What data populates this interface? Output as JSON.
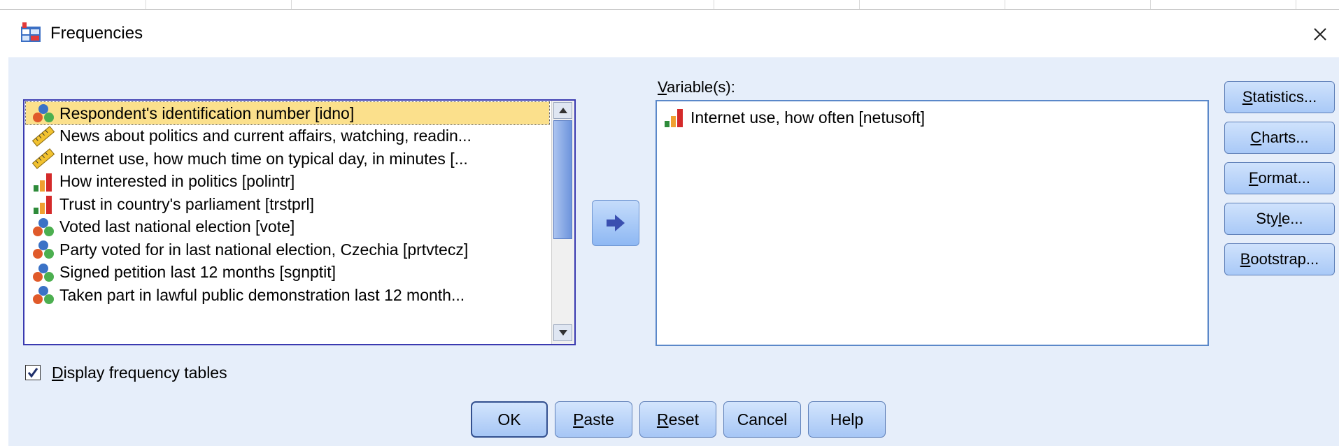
{
  "window": {
    "title": "Frequencies"
  },
  "source_list": {
    "items": [
      {
        "label": "Respondent's identification number [idno]",
        "icon": "nominal-icon",
        "selected": true
      },
      {
        "label": "News about politics and current affairs, watching, readin...",
        "icon": "scale-icon"
      },
      {
        "label": "Internet use, how much time on typical day, in minutes [...",
        "icon": "scale-icon"
      },
      {
        "label": "How interested in politics [polintr]",
        "icon": "ordinal-icon"
      },
      {
        "label": "Trust in country's parliament [trstprl]",
        "icon": "ordinal-icon"
      },
      {
        "label": "Voted last national election [vote]",
        "icon": "nominal-icon"
      },
      {
        "label": "Party voted for in last national election, Czechia [prtvtecz]",
        "icon": "nominal-icon"
      },
      {
        "label": "Signed petition last 12 months [sgnptit]",
        "icon": "nominal-icon"
      },
      {
        "label": "Taken part in lawful public demonstration last 12 month...",
        "icon": "nominal-icon"
      }
    ]
  },
  "variables": {
    "label": "Variable(s):",
    "label_access_key": "V",
    "label_rest": "ariable(s):",
    "items": [
      {
        "label": "Internet use, how often [netusoft]",
        "icon": "ordinal-icon"
      }
    ]
  },
  "side_buttons": [
    {
      "key": "S",
      "rest": "tatistics...",
      "full": "Statistics..."
    },
    {
      "key": "C",
      "rest": "harts...",
      "full": "Charts..."
    },
    {
      "key": "F",
      "rest": "ormat...",
      "full": "Format..."
    },
    {
      "pre": "Sty",
      "key": "l",
      "rest": "e...",
      "full": "Style..."
    },
    {
      "key": "B",
      "rest": "ootstrap...",
      "full": "Bootstrap..."
    }
  ],
  "display_tables": {
    "key": "D",
    "rest": "isplay frequency tables",
    "full": "Display frequency tables",
    "checked": true
  },
  "bottom_buttons": {
    "ok": "OK",
    "paste_key": "P",
    "paste_rest": "aste",
    "reset_key": "R",
    "reset_rest": "eset",
    "cancel": "Cancel",
    "help": "Help"
  },
  "colors": {
    "dialog_bg": "#e6eefa",
    "selection": "#fbe08c",
    "button_top": "#d3e5fd",
    "button_bottom": "#a6c6f5"
  }
}
